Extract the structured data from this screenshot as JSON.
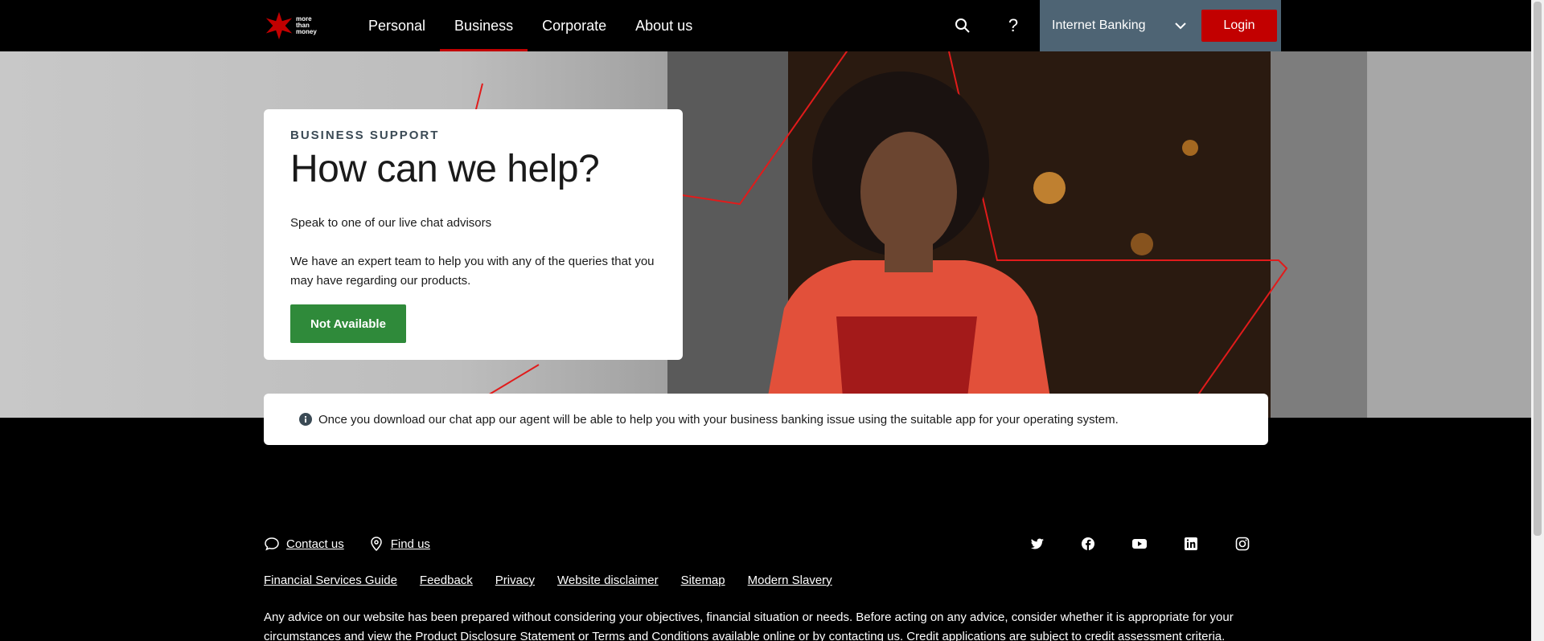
{
  "header": {
    "logo_text": "more than money",
    "nav": [
      {
        "label": "Personal"
      },
      {
        "label": "Business"
      },
      {
        "label": "Corporate"
      },
      {
        "label": "About us"
      }
    ],
    "active_nav": "Business",
    "internet_banking_label": "Internet Banking",
    "login_label": "Login"
  },
  "hero": {
    "eyebrow": "BUSINESS SUPPORT",
    "heading": "How can we help?",
    "intro": "Speak to one of our live chat advisors",
    "body": "We have an expert team to help you with any of the queries that you may have regarding our products.",
    "button_label": "Not Available"
  },
  "info_bar": {
    "text": "Once you download our chat app our agent will be able to help you with your business banking issue using the suitable app for your operating system."
  },
  "footer": {
    "contact_label": "Contact us",
    "find_label": "Find us",
    "links": [
      "Financial Services Guide",
      "Feedback",
      "Privacy",
      "Website disclaimer",
      "Sitemap",
      "Modern Slavery"
    ],
    "disclaimer": "Any advice on our website has been prepared without considering your objectives, financial situation or needs. Before acting on any advice, consider whether it is appropriate for your circumstances and view the Product Disclosure Statement or Terms and Conditions available online or by contacting us. Credit applications are subject to credit assessment criteria.",
    "social_icons": [
      "twitter-icon",
      "facebook-icon",
      "youtube-icon",
      "linkedin-icon",
      "instagram-icon"
    ]
  },
  "colors": {
    "brand_red": "#c20000",
    "available_green": "#2f8a3a",
    "ib_bg": "#4e6474"
  }
}
